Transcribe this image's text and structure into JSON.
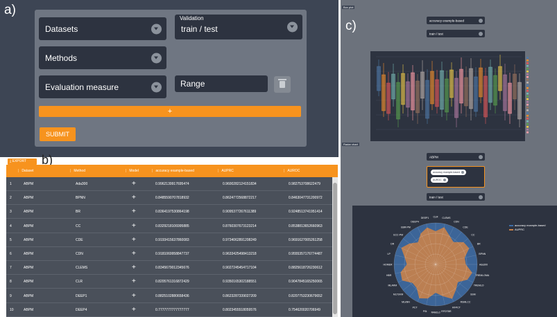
{
  "labels": {
    "a": "a)",
    "b": "b)",
    "c": "c)"
  },
  "form": {
    "datasets_label": "Datasets",
    "validation_floating_label": "Validation",
    "validation_value": "train / test",
    "methods_label": "Methods",
    "evaluation_label": "Evaluation measure",
    "range_placeholder": "Range",
    "add_label": "+",
    "submit_label": "SUBMIT"
  },
  "table": {
    "export_label": "EXPORT",
    "columns": [
      "Dataset",
      "Method",
      "Model",
      "accuracy example-based",
      "AUPRC",
      "AUROC"
    ],
    "rows": [
      {
        "n": "1",
        "dataset": "ABPM",
        "method": "Ada300",
        "model": "+",
        "acc": "0.9962139917695474",
        "auprc": "0.9600282124151834",
        "auroc": "0.982753708622479"
      },
      {
        "n": "2",
        "dataset": "ABPM",
        "method": "BPNN",
        "model": "+",
        "acc": "0.8485590707818932",
        "auprc": "0.8624772568872217",
        "auroc": "0.8463047731200972"
      },
      {
        "n": "3",
        "dataset": "ABPM",
        "method": "BR",
        "model": "+",
        "acc": "0.8364197530864198",
        "auprc": "0.9095377267611389",
        "auroc": "0.9248513741951414"
      },
      {
        "n": "4",
        "dataset": "ABPM",
        "method": "CC",
        "model": "+",
        "acc": "0.8329218106995885",
        "auprc": "0.8760307673123214",
        "auroc": "0.8538813652660963"
      },
      {
        "n": "5",
        "dataset": "ABPM",
        "method": "CDE",
        "model": "+",
        "acc": "0.9193415637860083",
        "auprc": "0.9734062891208249",
        "auroc": "0.9691627005261258"
      },
      {
        "n": "6",
        "dataset": "ABPM",
        "method": "CDN",
        "model": "+",
        "acc": "0.9181069958847737",
        "auprc": "0.9633425498413218",
        "auroc": "0.9555357176774487"
      },
      {
        "n": "7",
        "dataset": "ABPM",
        "method": "CLEMS",
        "model": "+",
        "acc": "0.8345679012345676",
        "auprc": "0.9027245454717104",
        "auroc": "0.8825618726230612"
      },
      {
        "n": "8",
        "dataset": "ABPM",
        "method": "CLR",
        "model": "+",
        "acc": "0.8205761316872429",
        "auprc": "0.9350165302188551",
        "auroc": "0.9047845165250065"
      },
      {
        "n": "9",
        "dataset": "ABPM",
        "method": "DEEP1",
        "model": "+",
        "acc": "0.8825102880658436",
        "auprc": "0.8623287339027209",
        "auroc": "0.8207753230679652"
      },
      {
        "n": "10",
        "dataset": "ABPM",
        "method": "DEEP4",
        "model": "+",
        "acc": "0.7777777777777777",
        "auprc": "0.8023455518059576",
        "auroc": "0.754620020706949"
      }
    ]
  },
  "panel_c": {
    "boxplot_title": "Box plot",
    "boxplot_metric": "accuracy example-based",
    "boxplot_validation": "train / test",
    "radar_title": "Radar chart",
    "radar_dataset": "ABPM",
    "radar_chips": [
      "accuracy example-based",
      "AUROC"
    ],
    "radar_validation": "train / test",
    "radar_legend": [
      "accuracy example-based",
      "AUPRC"
    ],
    "radar_methods": [
      "CLR",
      "CLEMS",
      "CDN",
      "CDE",
      "CC",
      "BR",
      "BPNN",
      "Ada300",
      "TREMLOMA",
      "TREMLO",
      "SSM",
      "RSMLCC",
      "RFPCT",
      "RFDTBR",
      "RAkELd",
      "PSt",
      "PCT",
      "MLkNN",
      "MLTSVM",
      "MLARM",
      "HBR",
      "HOMER",
      "LP",
      "DR",
      "ECC-PM",
      "EBR-PM",
      "DEEP4",
      "DEEP1"
    ]
  },
  "colors": {
    "accent": "#f7931e",
    "panel_dark": "#3d4554",
    "field": "#2d3340",
    "card": "#6f7682",
    "table_bg": "#4a505a"
  }
}
